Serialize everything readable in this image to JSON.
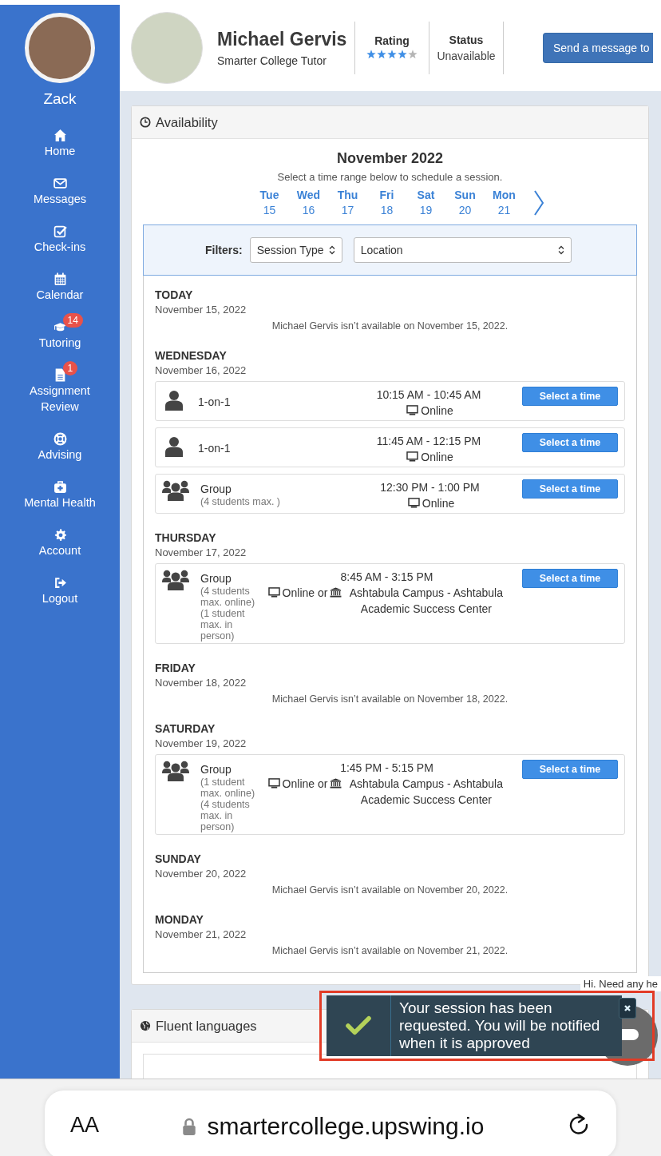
{
  "sidebar": {
    "user_name": "Zack",
    "items": [
      {
        "label": "Home"
      },
      {
        "label": "Messages"
      },
      {
        "label": "Check-ins"
      },
      {
        "label": "Calendar"
      },
      {
        "label": "Tutoring",
        "badge": "14"
      },
      {
        "label": "Assignment Review",
        "badge": "1"
      },
      {
        "label": "Advising"
      },
      {
        "label": "Mental Health"
      },
      {
        "label": "Account"
      },
      {
        "label": "Logout"
      }
    ]
  },
  "tutor": {
    "name": "Michael Gervis",
    "role": "Smarter College Tutor",
    "rating_label": "Rating",
    "stars": 4,
    "status_label": "Status",
    "status": "Unavailable",
    "message_button": "Send a message to"
  },
  "availability": {
    "title": "Availability",
    "month": "November 2022",
    "instructions": "Select a time range below to schedule a session.",
    "week": [
      {
        "day": "Tue",
        "date": "15"
      },
      {
        "day": "Wed",
        "date": "16"
      },
      {
        "day": "Thu",
        "date": "17"
      },
      {
        "day": "Fri",
        "date": "18"
      },
      {
        "day": "Sat",
        "date": "19"
      },
      {
        "day": "Sun",
        "date": "20"
      },
      {
        "day": "Mon",
        "date": "21"
      }
    ],
    "filters": {
      "label": "Filters:",
      "session_type": "Session Type",
      "location": "Location"
    },
    "days": [
      {
        "name": "TODAY",
        "date": "November 15, 2022",
        "note": "Michael Gervis isn’t available on November 15, 2022."
      },
      {
        "name": "WEDNESDAY",
        "date": "November 16, 2022",
        "slots": [
          {
            "kind": "single",
            "type": "1-on-1",
            "time": "10:15 AM - 10:45 AM",
            "locations": [
              {
                "kind": "online",
                "text": "Online"
              }
            ],
            "button": "Select a time"
          },
          {
            "kind": "single",
            "type": "1-on-1",
            "time": "11:45 AM - 12:15 PM",
            "locations": [
              {
                "kind": "online",
                "text": "Online"
              }
            ],
            "button": "Select a time"
          },
          {
            "kind": "group",
            "type": "Group",
            "details": [
              "(4 students max. )"
            ],
            "time": "12:30 PM - 1:00 PM",
            "locations": [
              {
                "kind": "online",
                "text": "Online"
              }
            ],
            "button": "Select a time"
          }
        ]
      },
      {
        "name": "THURSDAY",
        "date": "November 17, 2022",
        "slots": [
          {
            "kind": "group",
            "type": "Group",
            "details": [
              "(4 students max. online)",
              "(1 student max. in person)"
            ],
            "time": "8:45 AM - 3:15 PM",
            "locations": [
              {
                "kind": "online",
                "text": "Online or"
              },
              {
                "kind": "campus",
                "text": "Ashtabula Campus - Ashtabula Academic Success Center"
              }
            ],
            "button": "Select a time"
          }
        ]
      },
      {
        "name": "FRIDAY",
        "date": "November 18, 2022",
        "note": "Michael Gervis isn’t available on November 18, 2022."
      },
      {
        "name": "SATURDAY",
        "date": "November 19, 2022",
        "slots": [
          {
            "kind": "group",
            "type": "Group",
            "details": [
              "(1 student max. online)",
              "(4 students max. in person)"
            ],
            "time": "1:45 PM - 5:15 PM",
            "locations": [
              {
                "kind": "online",
                "text": "Online or"
              },
              {
                "kind": "campus",
                "text": "Ashtabula Campus - Ashtabula Academic Success Center"
              }
            ],
            "button": "Select a time"
          }
        ]
      },
      {
        "name": "SUNDAY",
        "date": "November 20, 2022",
        "note": "Michael Gervis isn’t available on November 20, 2022."
      },
      {
        "name": "MONDAY",
        "date": "November 21, 2022",
        "note": "Michael Gervis isn’t available on November 21, 2022."
      }
    ]
  },
  "languages": {
    "title": "Fluent languages"
  },
  "chat_hint": "Hi. Need any he",
  "toast": {
    "message": "Your session has been requested. You will be notified when it is approved"
  },
  "browser": {
    "text_size": "AA",
    "url": "smartercollege.upswing.io"
  }
}
